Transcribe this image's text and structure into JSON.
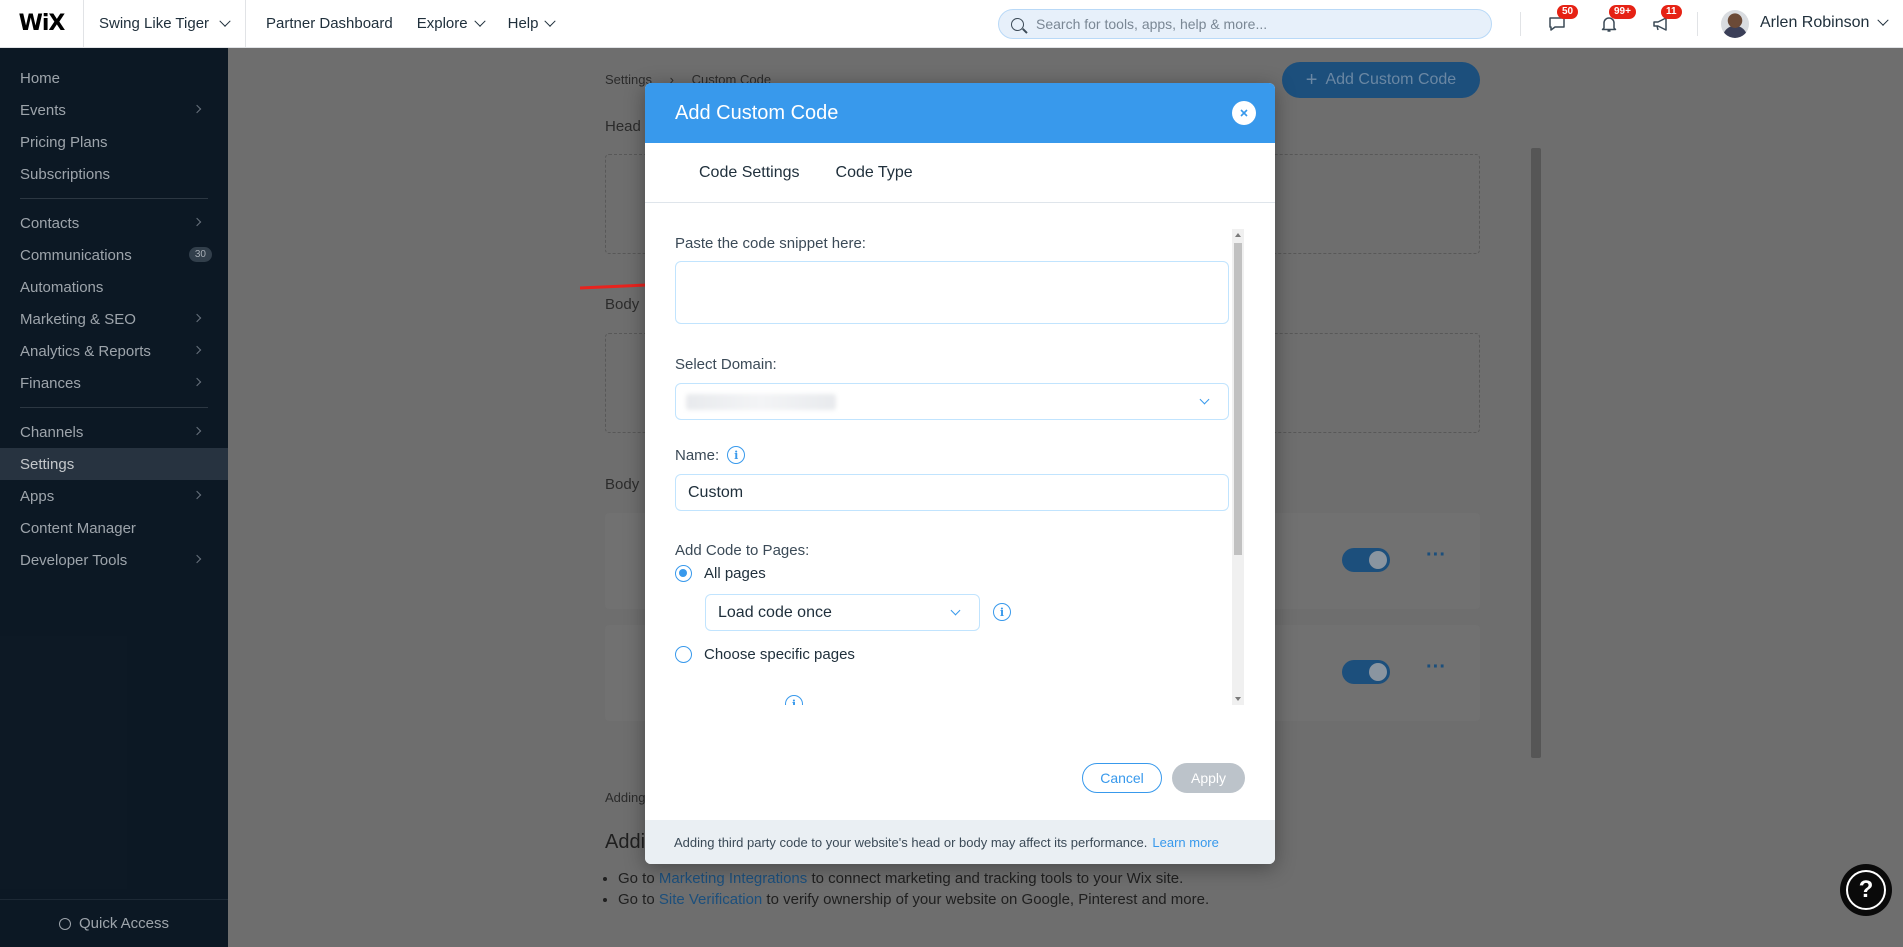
{
  "header": {
    "logo": "WiX",
    "site_name": "Swing Like Tiger",
    "nav": [
      "Partner Dashboard",
      "Explore",
      "Help"
    ],
    "search_placeholder": "Search for tools, apps, help & more...",
    "badges": {
      "messages": "50",
      "notifications": "99+",
      "announcements": "11"
    },
    "user_name": "Arlen Robinson"
  },
  "sidebar": {
    "group1": [
      "Home",
      "Events",
      "Pricing Plans",
      "Subscriptions"
    ],
    "group2": [
      "Contacts",
      "Communications",
      "Automations",
      "Marketing & SEO",
      "Analytics & Reports",
      "Finances"
    ],
    "communications_count": "30",
    "group3": [
      "Channels",
      "Settings",
      "Apps",
      "Content Manager",
      "Developer Tools"
    ],
    "quick_access": "Quick Access"
  },
  "background": {
    "breadcrumb_1": "Settings",
    "breadcrumb_2": "Custom Code",
    "add_button": "Add Custom Code",
    "section_head": "Head",
    "section_body_start": "Body",
    "section_body_end": "Body",
    "note": "Adding",
    "heading": "Addi",
    "list_item_1_pre": "Go to",
    "list_item_1_link": "Marketing Integrations",
    "list_item_1_post": "to connect marketing and tracking tools to your Wix site.",
    "list_item_2_pre": "Go to",
    "list_item_2_link": "Site Verification",
    "list_item_2_post": "to verify ownership of your website on Google, Pinterest and more."
  },
  "modal": {
    "title": "Add Custom Code",
    "tabs": [
      "Code Settings",
      "Code Type"
    ],
    "code_label": "Paste the code snippet here:",
    "domain_label": "Select Domain:",
    "name_label": "Name:",
    "name_value": "Custom",
    "pages_label": "Add Code to Pages:",
    "option_all": "All pages",
    "load_option": "Load code once",
    "option_specific": "Choose specific pages",
    "cancel": "Cancel",
    "apply": "Apply",
    "footer_text": "Adding third party code to your website's head or body may affect its performance.",
    "footer_link": "Learn more"
  },
  "colors": {
    "accent": "#3899ec",
    "sidebar_bg": "#0f1d2b",
    "badge": "#e62214",
    "arrow": "#e8231e"
  },
  "icons": [
    "search-icon",
    "chat-icon",
    "bell-icon",
    "megaphone-icon",
    "close-icon",
    "info-icon",
    "chevron-down-icon",
    "help-icon",
    "quick-access-icon"
  ]
}
